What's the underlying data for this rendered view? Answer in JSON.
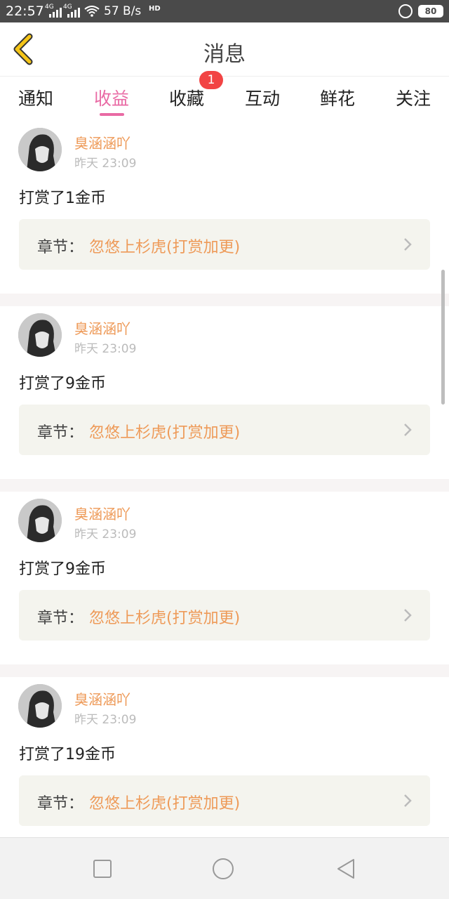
{
  "status_bar": {
    "time": "22:57",
    "net_a": "4G",
    "net_b": "4G",
    "speed": "57 B/s",
    "hd": "HD",
    "battery": "80"
  },
  "header": {
    "title": "消息",
    "back_icon": "chevron-left-icon",
    "accent_color": "#f5c518"
  },
  "tabs": [
    {
      "label": "通知",
      "active": false
    },
    {
      "label": "收益",
      "active": true
    },
    {
      "label": "收藏",
      "active": false,
      "badge": "1"
    },
    {
      "label": "互动",
      "active": false
    },
    {
      "label": "鲜花",
      "active": false
    },
    {
      "label": "关注",
      "active": false
    }
  ],
  "colors": {
    "active_tab": "#e96aa4",
    "name": "#ee9a58",
    "badge": "#f24444"
  },
  "messages": [
    {
      "user": "臭涵涵吖",
      "time": "昨天 23:09",
      "text": "打赏了1金币",
      "chapter_label": "章节：",
      "chapter": "忽悠上杉虎(打赏加更)"
    },
    {
      "user": "臭涵涵吖",
      "time": "昨天 23:09",
      "text": "打赏了9金币",
      "chapter_label": "章节：",
      "chapter": "忽悠上杉虎(打赏加更)"
    },
    {
      "user": "臭涵涵吖",
      "time": "昨天 23:09",
      "text": "打赏了9金币",
      "chapter_label": "章节：",
      "chapter": "忽悠上杉虎(打赏加更)"
    },
    {
      "user": "臭涵涵吖",
      "time": "昨天 23:09",
      "text": "打赏了19金币",
      "chapter_label": "章节：",
      "chapter": "忽悠上杉虎(打赏加更)"
    }
  ],
  "nav_bar": {
    "recents_icon": "square-icon",
    "home_icon": "circle-icon",
    "back_icon": "triangle-back-icon"
  }
}
